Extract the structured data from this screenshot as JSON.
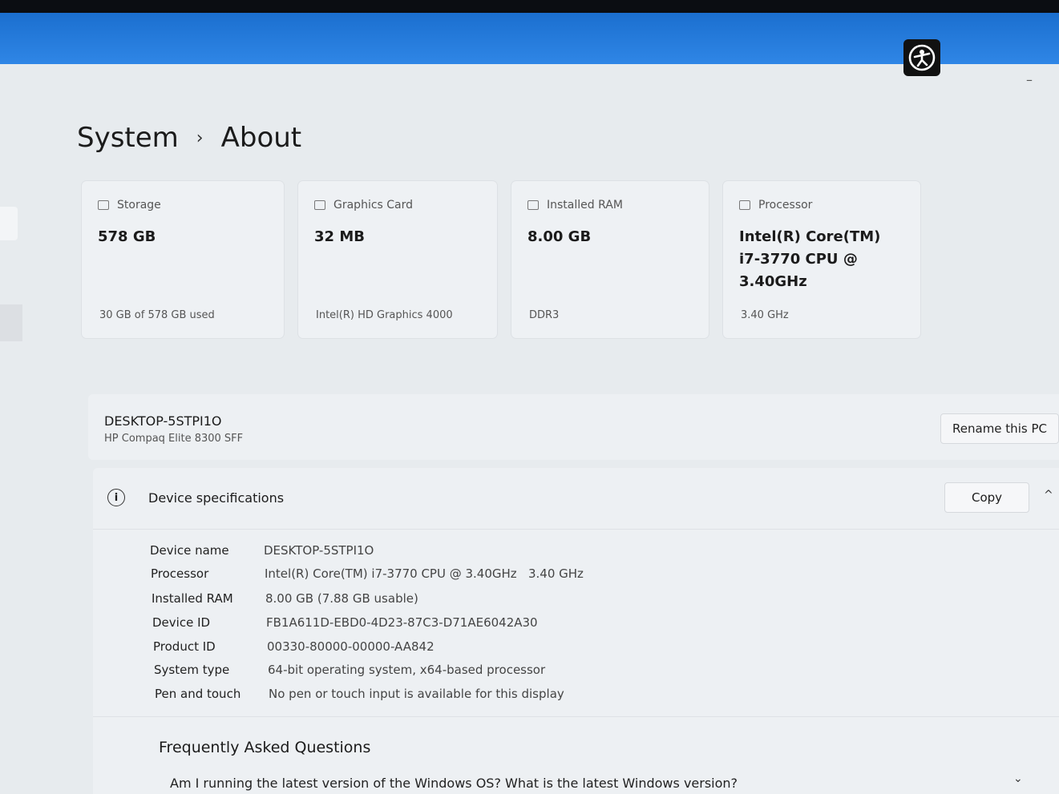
{
  "header": {
    "badge_icon": "accessibility-icon",
    "minimize_glyph": "–"
  },
  "breadcrumb": {
    "parent": "System",
    "separator": "›",
    "current": "About"
  },
  "cards": [
    {
      "icon": "storage-icon",
      "label": "Storage",
      "value": "578 GB",
      "sub": "30 GB of 578 GB used"
    },
    {
      "icon": "graphics-card-icon",
      "label": "Graphics Card",
      "value": "32 MB",
      "sub": "Intel(R) HD Graphics 4000"
    },
    {
      "icon": "ram-icon",
      "label": "Installed RAM",
      "value": "8.00 GB",
      "sub": "DDR3"
    },
    {
      "icon": "processor-icon",
      "label": "Processor",
      "value": "Intel(R) Core(TM)\ni7-3770 CPU @\n3.40GHz",
      "sub": "3.40 GHz"
    }
  ],
  "pc": {
    "name": "DESKTOP-5STPI1O",
    "model": "HP Compaq Elite 8300 SFF",
    "rename_label": "Rename this PC"
  },
  "specs": {
    "title": "Device specifications",
    "copy_label": "Copy",
    "collapse_glyph": "^",
    "rows": [
      {
        "key": "Device name",
        "value": "DESKTOP-5STPI1O"
      },
      {
        "key": "Processor",
        "value": "Intel(R) Core(TM) i7-3770 CPU @ 3.40GHz   3.40 GHz"
      },
      {
        "key": "Installed RAM",
        "value": "8.00 GB (7.88 GB usable)"
      },
      {
        "key": "Device ID",
        "value": "FB1A611D-EBD0-4D23-87C3-D71AE6042A30"
      },
      {
        "key": "Product ID",
        "value": "00330-80000-00000-AA842"
      },
      {
        "key": "System type",
        "value": "64-bit operating system, x64-based processor"
      },
      {
        "key": "Pen and touch",
        "value": "No pen or touch input is available for this display"
      }
    ]
  },
  "faq": {
    "title": "Frequently Asked Questions",
    "question": "Am I running the latest version of the Windows OS? What is the latest Windows version?",
    "chevron_glyph": "⌄"
  }
}
